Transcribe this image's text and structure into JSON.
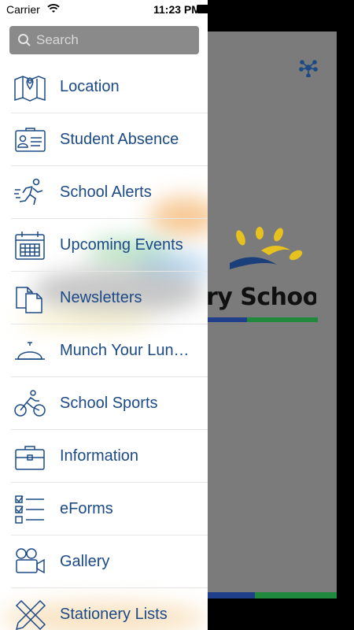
{
  "status_bar": {
    "carrier": "Carrier",
    "time": "11:23 PM"
  },
  "search": {
    "placeholder": "Search",
    "value": ""
  },
  "menu": {
    "items": [
      {
        "label": "Location",
        "icon": "map-location-icon"
      },
      {
        "label": "Student Absence",
        "icon": "id-card-icon"
      },
      {
        "label": "School Alerts",
        "icon": "runner-icon"
      },
      {
        "label": "Upcoming Events",
        "icon": "calendar-icon"
      },
      {
        "label": "Newsletters",
        "icon": "documents-icon"
      },
      {
        "label": "Munch Your Lun…",
        "icon": "service-bell-icon"
      },
      {
        "label": "School Sports",
        "icon": "cyclist-icon"
      },
      {
        "label": "Information",
        "icon": "briefcase-icon"
      },
      {
        "label": "eForms",
        "icon": "checklist-icon"
      },
      {
        "label": "Gallery",
        "icon": "video-camera-icon"
      },
      {
        "label": "Stationery Lists",
        "icon": "ruler-pencil-icon"
      }
    ]
  },
  "background": {
    "logo_text": "ry School"
  },
  "colors": {
    "menu_text": "#1b4a86",
    "icon_stroke": "#1b4a86",
    "search_bg": "#8a8a8a",
    "overlay": "#7b7b7b"
  }
}
